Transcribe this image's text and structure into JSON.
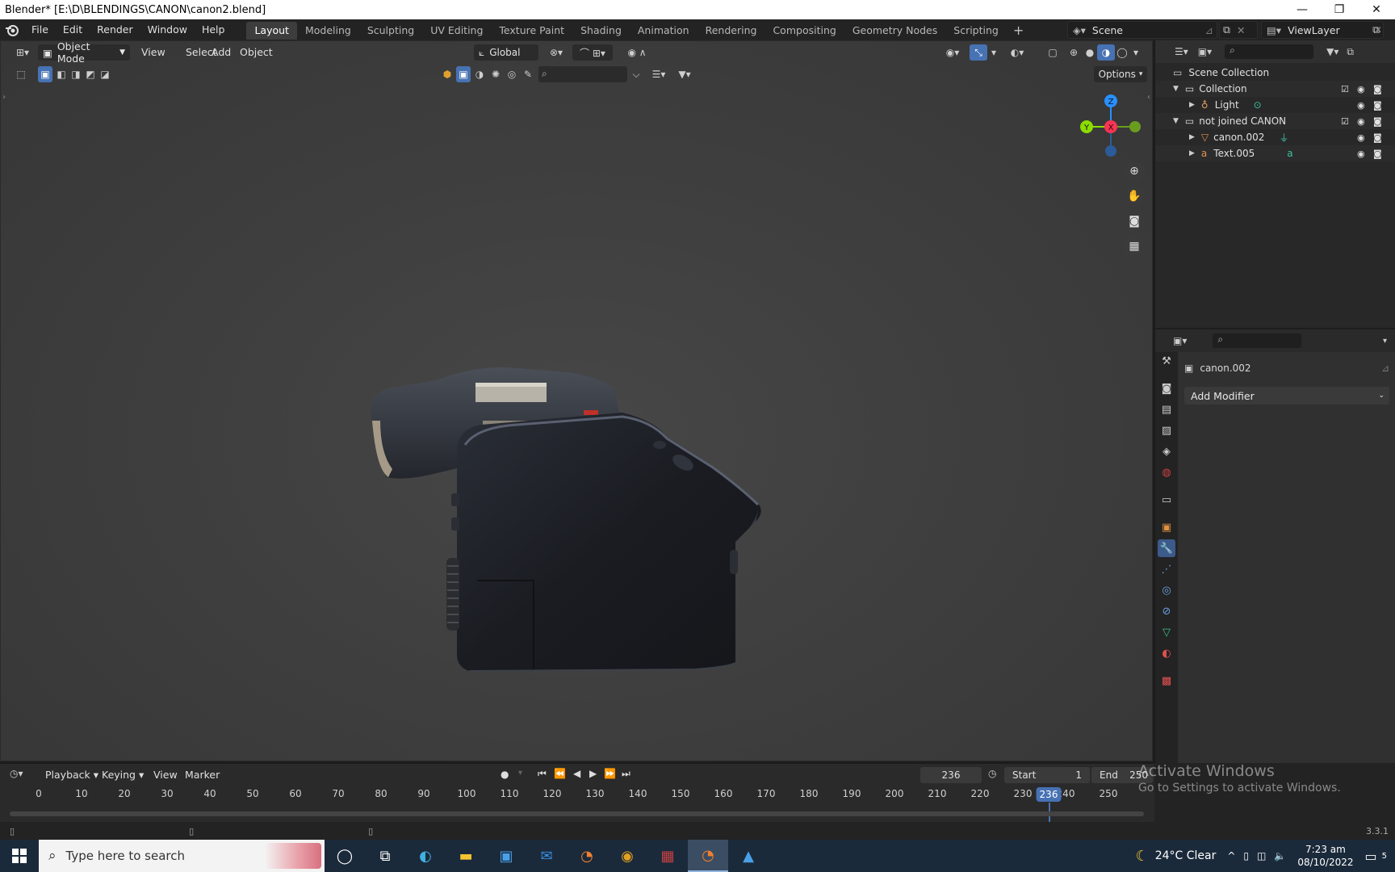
{
  "window": {
    "title": "Blender* [E:\\D\\BLENDINGS\\CANON\\canon2.blend]",
    "minimize": "—",
    "restore": "❐",
    "close": "✕"
  },
  "menu": [
    "File",
    "Edit",
    "Render",
    "Window",
    "Help"
  ],
  "workspaces": [
    "Layout",
    "Modeling",
    "Sculpting",
    "UV Editing",
    "Texture Paint",
    "Shading",
    "Animation",
    "Rendering",
    "Compositing",
    "Geometry Nodes",
    "Scripting"
  ],
  "active_workspace": "Layout",
  "scene": "Scene",
  "view_layer": "ViewLayer",
  "viewport": {
    "mode": "Object Mode",
    "menus": [
      "View",
      "Select",
      "Add",
      "Object"
    ],
    "transform_orientation": "Global",
    "options": "Options",
    "gizmo": {
      "z": "Z",
      "y": "Y",
      "x": "X"
    }
  },
  "outliner": {
    "rows": [
      {
        "label": "Scene Collection"
      },
      {
        "label": "Collection"
      },
      {
        "label": "Light"
      },
      {
        "label": "not joined CANON"
      },
      {
        "label": "canon.002"
      },
      {
        "label": "Text.005"
      }
    ]
  },
  "properties": {
    "object_name": "canon.002",
    "add_modifier": "Add Modifier"
  },
  "timeline": {
    "menus": [
      "Playback",
      "Keying",
      "View",
      "Marker"
    ],
    "current_frame": "236",
    "start_label": "Start",
    "start": "1",
    "end_label": "End",
    "end": "250",
    "ticks": [
      "0",
      "10",
      "20",
      "30",
      "40",
      "50",
      "60",
      "70",
      "80",
      "90",
      "100",
      "110",
      "120",
      "130",
      "140",
      "150",
      "160",
      "170",
      "180",
      "190",
      "200",
      "210",
      "220",
      "230",
      "240",
      "250"
    ],
    "playhead": "236"
  },
  "status": {
    "version": "3.3.1"
  },
  "watermark": {
    "line1": "Activate Windows",
    "line2": "Go to Settings to activate Windows."
  },
  "taskbar": {
    "search_placeholder": "Type here to search",
    "weather": "24°C  Clear",
    "time": "7:23 am",
    "date": "08/10/2022",
    "notifications": "5"
  },
  "colors": {
    "accent": "#4772b3",
    "x_axis": "#ff3352",
    "y_axis": "#8bdc00",
    "z_axis": "#2890ff"
  }
}
